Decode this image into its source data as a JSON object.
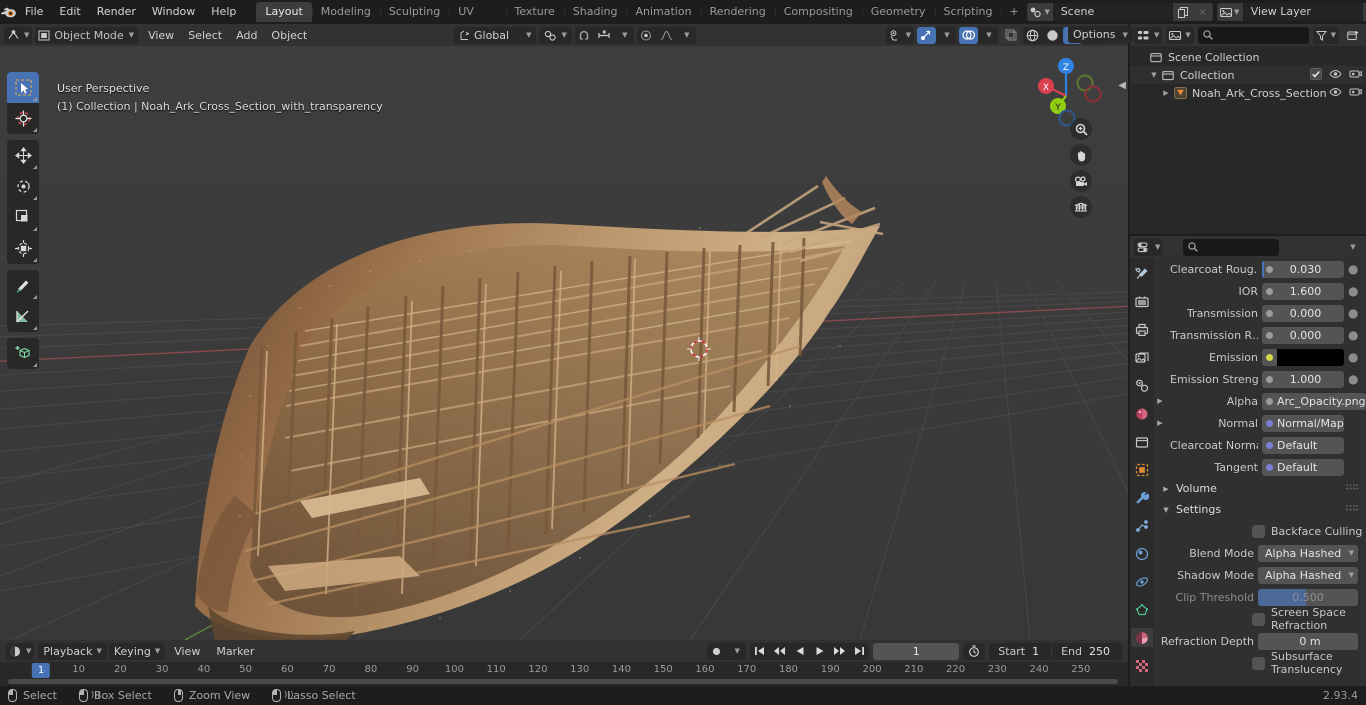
{
  "app": {
    "title": "Blender",
    "version": "2.93.4"
  },
  "topbar": {
    "menus": [
      "File",
      "Edit",
      "Render",
      "Window",
      "Help"
    ],
    "workspace_tabs": [
      {
        "label": "Layout",
        "active": true
      },
      {
        "label": "Modeling",
        "active": false
      },
      {
        "label": "Sculpting",
        "active": false
      },
      {
        "label": "UV Editing",
        "active": false
      },
      {
        "label": "Texture Paint",
        "active": false
      },
      {
        "label": "Shading",
        "active": false
      },
      {
        "label": "Animation",
        "active": false
      },
      {
        "label": "Rendering",
        "active": false
      },
      {
        "label": "Compositing",
        "active": false
      },
      {
        "label": "Geometry Nodes",
        "active": false
      },
      {
        "label": "Scripting",
        "active": false
      }
    ],
    "add_workspace_label": "+",
    "scene": {
      "name": "Scene",
      "icon": "scene-icon",
      "copy_label": "copy",
      "close_label": "×"
    },
    "view_layer": {
      "name": "View Layer",
      "icon": "view-layer-icon",
      "copy_label": "copy",
      "close_label": "×"
    }
  },
  "viewport_header": {
    "mode": "Object Mode",
    "menus": [
      "View",
      "Select",
      "Add",
      "Object"
    ],
    "transform_orientation": "Global",
    "snap_icon": "magnet-icon",
    "proportional_icon": "proportional-edit-icon",
    "options_label": "Options",
    "shading_modes": [
      "wireframe",
      "solid",
      "material-preview",
      "rendered"
    ],
    "active_shading": "material-preview"
  },
  "viewport": {
    "perspective_label": "User Perspective",
    "scene_info": "(1) Collection | Noah_Ark_Cross_Section_with_transparency",
    "gizmo_axes": [
      {
        "name": "X",
        "color": "#d9414f"
      },
      {
        "name": "Y",
        "color": "#90cc12"
      },
      {
        "name": "Z",
        "color": "#2f83e3"
      }
    ],
    "nav_buttons": [
      "zoom-icon",
      "hand-icon",
      "camera-icon",
      "grid-icon"
    ],
    "tools": [
      {
        "name": "tweak-tool",
        "label": "Tweak",
        "active": true
      },
      {
        "name": "cursor-tool",
        "label": "Cursor",
        "active": false
      },
      {
        "name": "move-tool",
        "label": "Move",
        "active": false
      },
      {
        "name": "rotate-tool",
        "label": "Rotate",
        "active": false
      },
      {
        "name": "scale-tool",
        "label": "Scale",
        "active": false
      },
      {
        "name": "transform-tool",
        "label": "Transform",
        "active": false
      },
      {
        "name": "annotate-tool",
        "label": "Annotate",
        "active": false
      },
      {
        "name": "measure-tool",
        "label": "Measure",
        "active": false
      },
      {
        "name": "add-cube-tool",
        "label": "Add Cube",
        "active": false
      }
    ]
  },
  "timeline": {
    "editor_icon": "timeline-icon",
    "menus": [
      "Playback",
      "Keying",
      "View",
      "Marker"
    ],
    "keying_set_icon": "record-icon",
    "transport": [
      "jump-start",
      "prev-keyframe",
      "play-reverse",
      "play",
      "next-keyframe",
      "jump-end"
    ],
    "current_frame": "1",
    "auto_key_icon": "stopwatch-icon",
    "start_label": "Start",
    "start_value": "1",
    "end_label": "End",
    "end_value": "250",
    "ticks": [
      10,
      20,
      30,
      40,
      50,
      60,
      70,
      80,
      90,
      100,
      110,
      120,
      130,
      140,
      150,
      160,
      170,
      180,
      190,
      200,
      210,
      220,
      230,
      240,
      250
    ],
    "playhead_frame": 1
  },
  "outliner": {
    "display_mode_icon": "outliner-display-icon",
    "filter_icon": "filter-icon",
    "new_collection_icon": "new-collection-icon",
    "search_placeholder": "",
    "rows": [
      {
        "name": "Scene Collection",
        "icon": "collection-icon",
        "depth": 0,
        "expander": "",
        "checkbox": false,
        "eye": false,
        "camera": false,
        "selected": false
      },
      {
        "name": "Collection",
        "icon": "collection-icon",
        "depth": 1,
        "expander": "▼",
        "checkbox": true,
        "eye": true,
        "camera": true,
        "selected": true
      },
      {
        "name": "Noah_Ark_Cross_Section",
        "icon": "mesh-object-icon",
        "depth": 2,
        "expander": "▶",
        "checkbox": false,
        "eye": true,
        "camera": true,
        "selected": false
      }
    ]
  },
  "properties": {
    "editor_icon": "properties-icon",
    "search_placeholder": "",
    "tabs": [
      {
        "name": "tool-tab",
        "icon": "tool-icon",
        "active": false
      },
      {
        "name": "render-tab",
        "icon": "render-icon",
        "active": false
      },
      {
        "name": "output-tab",
        "icon": "printer-icon",
        "active": false
      },
      {
        "name": "view-layer-tab",
        "icon": "images-icon",
        "active": false
      },
      {
        "name": "scene-tab",
        "icon": "scene-cone-icon",
        "active": false
      },
      {
        "name": "world-tab",
        "icon": "world-icon",
        "active": false
      },
      {
        "name": "collection-tab",
        "icon": "collection-box-icon",
        "active": false
      },
      {
        "name": "object-tab",
        "icon": "object-square-icon",
        "active": false
      },
      {
        "name": "modifier-tab",
        "icon": "wrench-icon",
        "active": false
      },
      {
        "name": "particles-tab",
        "icon": "particles-icon",
        "active": false
      },
      {
        "name": "physics-tab",
        "icon": "physics-icon",
        "active": false
      },
      {
        "name": "constraints-tab",
        "icon": "constraint-icon",
        "active": false
      },
      {
        "name": "data-tab",
        "icon": "mesh-data-icon",
        "active": false
      },
      {
        "name": "material-tab",
        "icon": "material-sphere-icon",
        "active": true
      },
      {
        "name": "texture-tab",
        "icon": "checker-icon",
        "active": false
      }
    ],
    "fields": [
      {
        "label": "Clearcoat Roug…",
        "value": "0.030",
        "kind": "number",
        "dot": "grey",
        "animatable": true,
        "accent": true
      },
      {
        "label": "IOR",
        "value": "1.600",
        "kind": "number",
        "dot": "grey",
        "animatable": true
      },
      {
        "label": "Transmission",
        "value": "0.000",
        "kind": "number",
        "dot": "grey",
        "animatable": true
      },
      {
        "label": "Transmission R…",
        "value": "0.000",
        "kind": "number",
        "dot": "grey",
        "animatable": true
      },
      {
        "label": "Emission",
        "value": "",
        "kind": "color",
        "dot": "yellow",
        "animatable": true,
        "color": "#000000"
      },
      {
        "label": "Emission Strengt",
        "value": "1.000",
        "kind": "number",
        "dot": "grey",
        "animatable": true
      },
      {
        "label": "Alpha",
        "value": "Arc_Opacity.png",
        "kind": "link",
        "dot": "grey",
        "expander": "▶"
      },
      {
        "label": "Normal",
        "value": "Normal/Map",
        "kind": "link",
        "dot": "purple",
        "expander": "▶"
      },
      {
        "label": "Clearcoat Normal",
        "value": "Default",
        "kind": "link",
        "dot": "purple"
      },
      {
        "label": "Tangent",
        "value": "Default",
        "kind": "link",
        "dot": "purple"
      }
    ],
    "panels": [
      {
        "label": "Volume",
        "expanded": false
      },
      {
        "label": "Settings",
        "expanded": true
      }
    ],
    "settings": {
      "backface_culling": {
        "label": "Backface Culling",
        "checked": false
      },
      "blend_mode": {
        "label": "Blend Mode",
        "value": "Alpha Hashed"
      },
      "shadow_mode": {
        "label": "Shadow Mode",
        "value": "Alpha Hashed"
      },
      "clip_threshold": {
        "label": "Clip Threshold",
        "value": "0.500",
        "fill_percent": 48,
        "disabled": true
      },
      "screen_space_refraction": {
        "label": "Screen Space Refraction",
        "checked": false
      },
      "refraction_depth": {
        "label": "Refraction Depth",
        "value": "0 m"
      },
      "subsurface_translucency": {
        "label": "Subsurface Translucency",
        "checked": false
      }
    }
  },
  "statusbar": {
    "hints": [
      {
        "icon": "mouse-left-icon",
        "label": "Select"
      },
      {
        "icon": "mouse-left-drag-icon",
        "label": "Box Select"
      },
      {
        "icon": "mouse-middle-icon",
        "label": "Zoom View"
      },
      {
        "icon": "mouse-left-drag-icon",
        "label": "Lasso Select"
      }
    ],
    "version": "2.93.4"
  }
}
